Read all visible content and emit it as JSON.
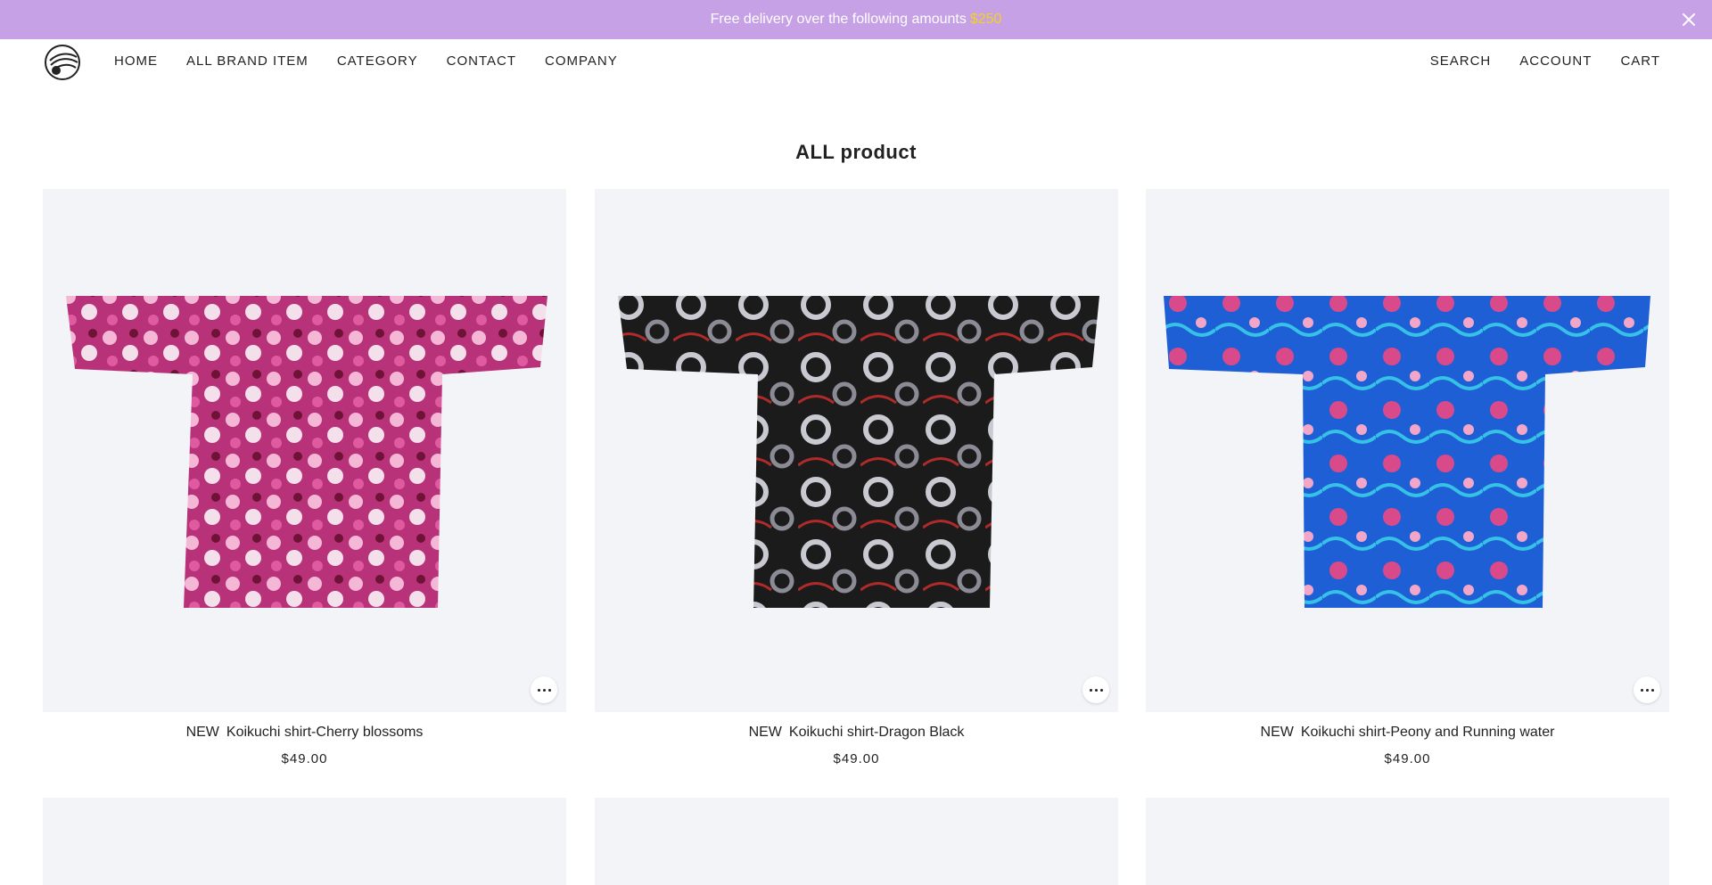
{
  "announcement": {
    "text": "Free delivery over the following amounts",
    "amount": "$250"
  },
  "header": {
    "logo_alt": "brand logo",
    "nav_left": [
      "HOME",
      "ALL BRAND ITEM",
      "CATEGORY",
      "CONTACT",
      "COMPANY"
    ],
    "nav_right": [
      "SEARCH",
      "ACCOUNT",
      "CART"
    ]
  },
  "main": {
    "title": "ALL product",
    "products": [
      {
        "badge": "NEW",
        "name": "Koikuchi shirt-Cherry blossoms",
        "price": "$49.00",
        "colors": {
          "base": "#b8327a",
          "accent": "#f4b7d6",
          "dark": "#6e1236"
        }
      },
      {
        "badge": "NEW",
        "name": "Koikuchi shirt-Dragon Black",
        "price": "$49.00",
        "colors": {
          "base": "#1b1b1b",
          "accent": "#c9c9d1",
          "dark": "#8b8b96"
        }
      },
      {
        "badge": "NEW",
        "name": "Koikuchi shirt-Peony and Running water",
        "price": "$49.00",
        "colors": {
          "base": "#1f5fd6",
          "accent": "#d94a8a",
          "dark": "#36c2e6"
        }
      }
    ]
  }
}
